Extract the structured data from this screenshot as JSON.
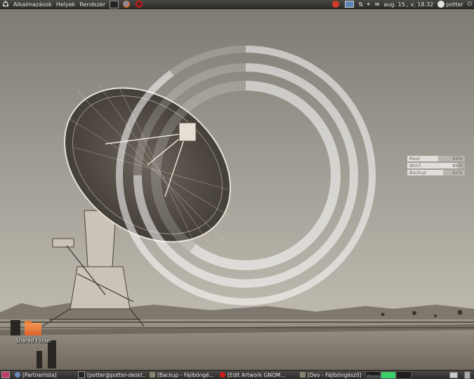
{
  "top_panel": {
    "menus": [
      "Alkalmazások",
      "Helyek",
      "Rendszer"
    ],
    "clock": "aug. 15., v, 18.32",
    "user": "potter",
    "icons": [
      "ubuntu-logo-icon",
      "terminal-icon",
      "firefox-icon",
      "opera-icon",
      "notification-icon",
      "display-icon",
      "network-icon",
      "volume-icon",
      "mail-icon",
      "power-icon"
    ]
  },
  "desktop": {
    "shared_folder_label": "Shared Folder"
  },
  "conky": {
    "disks": [
      {
        "label": "Root",
        "percent_text": "54%",
        "fraction": 0.54
      },
      {
        "label": "Win7",
        "percent_text": "88%",
        "fraction": 0.88
      },
      {
        "label": "Backup",
        "percent_text": "62%",
        "fraction": 0.62
      }
    ],
    "ring_fractions": [
      0.6,
      0.75,
      0.9
    ]
  },
  "bottom_panel": {
    "tasks": [
      "[Partnerlista]",
      "[potter@potter-deskt...",
      "[Backup - Fájlböngé...",
      "[Edit Artwork GNOM...",
      "[Dev - Fájlböngésző]"
    ],
    "workspace_label": "Webdev"
  },
  "colors": {
    "panel": "#2e2c29",
    "ring": "#ffffff",
    "folder": "#e57c3c"
  }
}
